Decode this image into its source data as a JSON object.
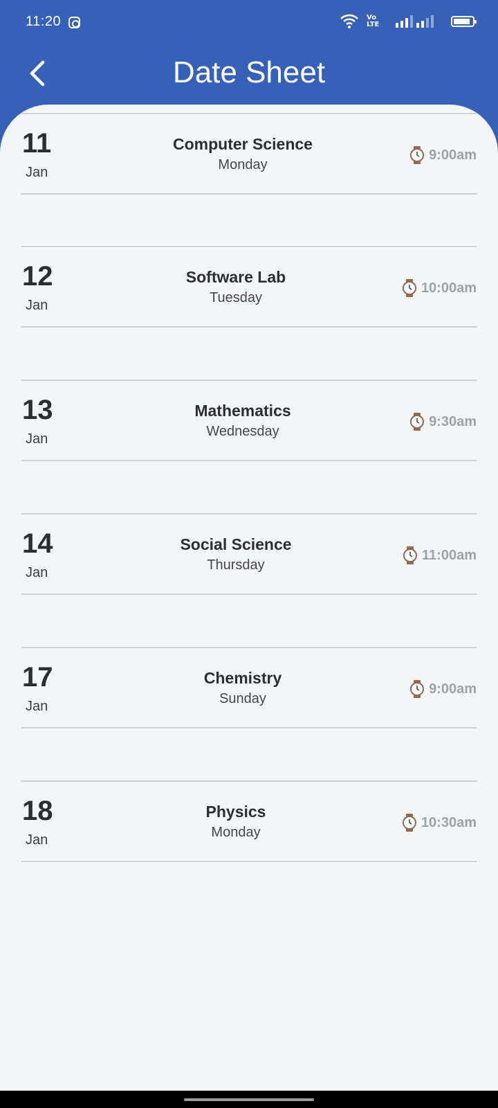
{
  "status_bar": {
    "time": "11:20",
    "volte": "Vo LTE",
    "icons": [
      "instagram-icon",
      "wifi-icon",
      "volte-icon",
      "signal-icon",
      "signal-icon",
      "battery-icon"
    ]
  },
  "header": {
    "title": "Date Sheet",
    "back_icon": "chevron-left-icon"
  },
  "colors": {
    "header_bg": "#3761b9",
    "content_bg": "#f4f5f7",
    "time_text": "#9fa1a6",
    "divider": "#d0d2d6"
  },
  "exams": [
    {
      "day": "11",
      "month": "Jan",
      "subject": "Computer Science",
      "weekday": "Monday",
      "time": "9:00am"
    },
    {
      "day": "12",
      "month": "Jan",
      "subject": "Software Lab",
      "weekday": "Tuesday",
      "time": "10:00am"
    },
    {
      "day": "13",
      "month": "Jan",
      "subject": "Mathematics",
      "weekday": "Wednesday",
      "time": "9:30am"
    },
    {
      "day": "14",
      "month": "Jan",
      "subject": "Social Science",
      "weekday": "Thursday",
      "time": "11:00am"
    },
    {
      "day": "17",
      "month": "Jan",
      "subject": "Chemistry",
      "weekday": "Sunday",
      "time": "9:00am"
    },
    {
      "day": "18",
      "month": "Jan",
      "subject": "Physics",
      "weekday": "Monday",
      "time": "10:30am"
    }
  ]
}
